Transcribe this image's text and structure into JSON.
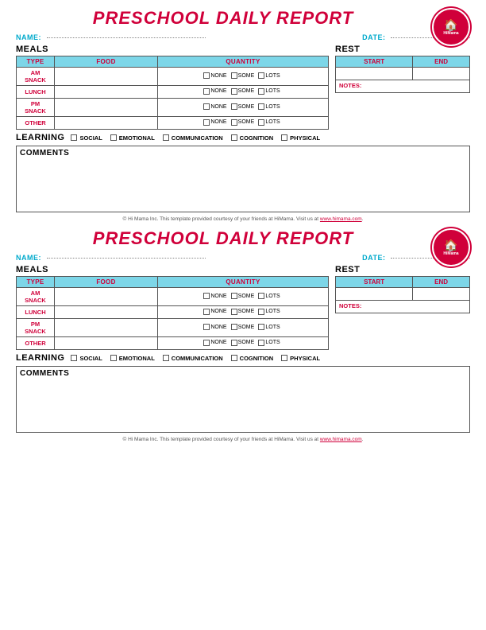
{
  "reports": [
    {
      "title": "PRESCHOOL DAILY REPORT",
      "name_label": "NAME:",
      "date_label": "DATE:",
      "meals_label": "MEALS",
      "rest_label": "REST",
      "meals_headers": [
        "TYPE",
        "FOOD",
        "QUANTITY"
      ],
      "rest_headers": [
        "START",
        "END"
      ],
      "notes_label": "NOTES:",
      "rows": [
        {
          "type": "AM SNACK"
        },
        {
          "type": "LUNCH"
        },
        {
          "type": "PM SNACK"
        },
        {
          "type": "OTHER"
        }
      ],
      "quantity_options": [
        "NONE",
        "SOME",
        "LOTS"
      ],
      "learning_label": "LEARNING",
      "learning_items": [
        "SOCIAL",
        "EMOTIONAL",
        "COMMUNICATION",
        "COGNITION",
        "PHYSICAL"
      ],
      "comments_label": "COMMENTS"
    },
    {
      "title": "PRESCHOOL DAILY REPORT",
      "name_label": "NAME:",
      "date_label": "DATE:",
      "meals_label": "MEALS",
      "rest_label": "REST",
      "meals_headers": [
        "TYPE",
        "FOOD",
        "QUANTITY"
      ],
      "rest_headers": [
        "START",
        "END"
      ],
      "notes_label": "NOTES:",
      "rows": [
        {
          "type": "AM SNACK"
        },
        {
          "type": "LUNCH"
        },
        {
          "type": "PM SNACK"
        },
        {
          "type": "OTHER"
        }
      ],
      "quantity_options": [
        "NONE",
        "SOME",
        "LOTS"
      ],
      "learning_label": "LEARNING",
      "learning_items": [
        "SOCIAL",
        "EMOTIONAL",
        "COMMUNICATION",
        "COGNITION",
        "PHYSICAL"
      ],
      "comments_label": "COMMENTS"
    }
  ],
  "footer": {
    "text_before": "© Hi Mama Inc.  This template provided courtesy of your friends at HiMama. Visit us at ",
    "link_text": "www.himama.com",
    "text_after": "."
  }
}
